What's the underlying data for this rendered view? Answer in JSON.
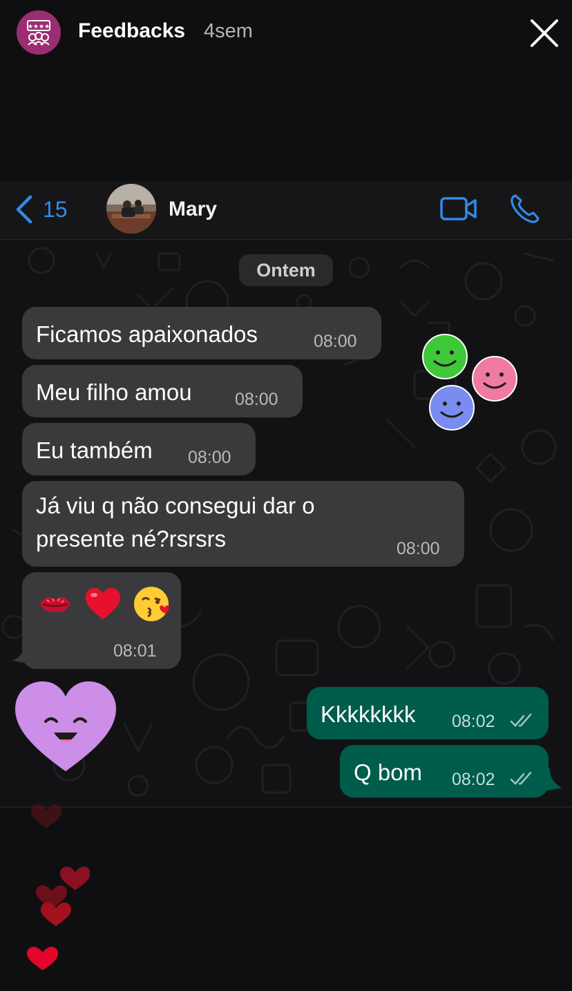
{
  "story": {
    "title": "Feedbacks",
    "age": "4sem",
    "avatar_color": "#9b2e73"
  },
  "chat_header": {
    "back_count": "15",
    "contact_name": "Mary",
    "accent_color": "#2f8ce6"
  },
  "date_separator": "Ontem",
  "messages": [
    {
      "direction": "in",
      "text": "Ficamos apaixonados",
      "time": "08:00"
    },
    {
      "direction": "in",
      "text": "Meu filho amou",
      "time": "08:00"
    },
    {
      "direction": "in",
      "text": "Eu também",
      "time": "08:00"
    },
    {
      "direction": "in",
      "text_line1": "Já viu q não consegui dar o",
      "text_line2": "presente né?rsrsrs",
      "time": "08:00"
    },
    {
      "direction": "in",
      "emojis": [
        "💋",
        "❤️",
        "😘"
      ],
      "time": "08:01"
    },
    {
      "direction": "out",
      "text": "Kkkkkkkk",
      "time": "08:02",
      "status": "read"
    },
    {
      "direction": "out",
      "text": "Q bom",
      "time": "08:02",
      "status": "read"
    }
  ],
  "stickers": [
    "green-smiley",
    "pink-smiley",
    "blue-smiley",
    "purple-heart-face"
  ],
  "colors": {
    "incoming_bubble": "#3a3a3d",
    "outgoing_bubble": "#005c4b",
    "background": "#121214"
  }
}
